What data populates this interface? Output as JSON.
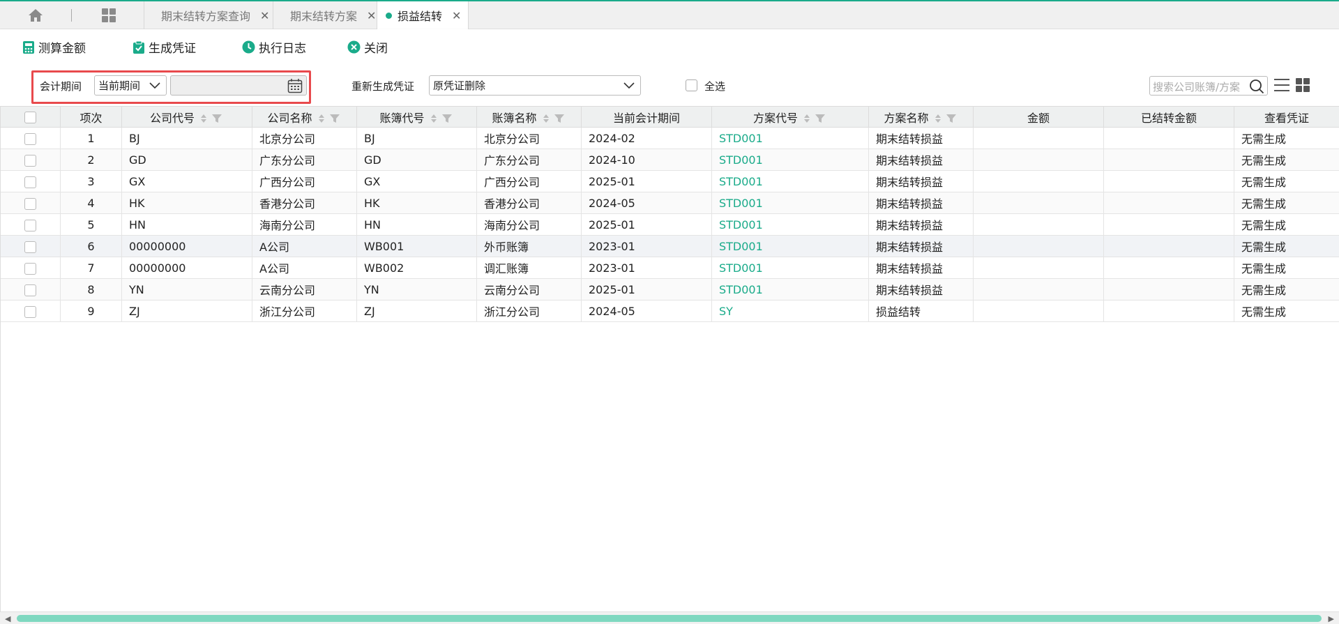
{
  "tabs": [
    {
      "label": "期末结转方案查询"
    },
    {
      "label": "期末结转方案"
    },
    {
      "label": "损益结转"
    }
  ],
  "toolbar": {
    "calc": "测算金额",
    "voucher": "生成凭证",
    "log": "执行日志",
    "close": "关闭"
  },
  "filter": {
    "period_label": "会计期间",
    "period_value": "当前期间",
    "date_value": "",
    "regen_label": "重新生成凭证",
    "regen_value": "原凭证删除",
    "select_all_label": "全选",
    "search_placeholder": "搜索公司账簿/方案"
  },
  "table": {
    "headers": [
      "项次",
      "公司代号",
      "公司名称",
      "账簿代号",
      "账簿名称",
      "当前会计期间",
      "方案代号",
      "方案名称",
      "金额",
      "已结转金额",
      "查看凭证"
    ],
    "rows": [
      [
        "1",
        "BJ",
        "北京分公司",
        "BJ",
        "北京分公司",
        "2024-02",
        "STD001",
        "期末结转损益",
        "",
        "",
        "无需生成"
      ],
      [
        "2",
        "GD",
        "广东分公司",
        "GD",
        "广东分公司",
        "2024-10",
        "STD001",
        "期末结转损益",
        "",
        "",
        "无需生成"
      ],
      [
        "3",
        "GX",
        "广西分公司",
        "GX",
        "广西分公司",
        "2025-01",
        "STD001",
        "期末结转损益",
        "",
        "",
        "无需生成"
      ],
      [
        "4",
        "HK",
        "香港分公司",
        "HK",
        "香港分公司",
        "2024-05",
        "STD001",
        "期末结转损益",
        "",
        "",
        "无需生成"
      ],
      [
        "5",
        "HN",
        "海南分公司",
        "HN",
        "海南分公司",
        "2025-01",
        "STD001",
        "期末结转损益",
        "",
        "",
        "无需生成"
      ],
      [
        "6",
        "00000000",
        "A公司",
        "WB001",
        "外币账簿",
        "2023-01",
        "STD001",
        "期末结转损益",
        "",
        "",
        "无需生成"
      ],
      [
        "7",
        "00000000",
        "A公司",
        "WB002",
        "调汇账簿",
        "2023-01",
        "STD001",
        "期末结转损益",
        "",
        "",
        "无需生成"
      ],
      [
        "8",
        "YN",
        "云南分公司",
        "YN",
        "云南分公司",
        "2025-01",
        "STD001",
        "期末结转损益",
        "",
        "",
        "无需生成"
      ],
      [
        "9",
        "ZJ",
        "浙江分公司",
        "ZJ",
        "浙江分公司",
        "2024-05",
        "SY",
        "损益结转",
        "",
        "",
        "无需生成"
      ]
    ]
  },
  "colors": {
    "accent": "#1aab8a",
    "highlight_border": "#e8494c"
  }
}
